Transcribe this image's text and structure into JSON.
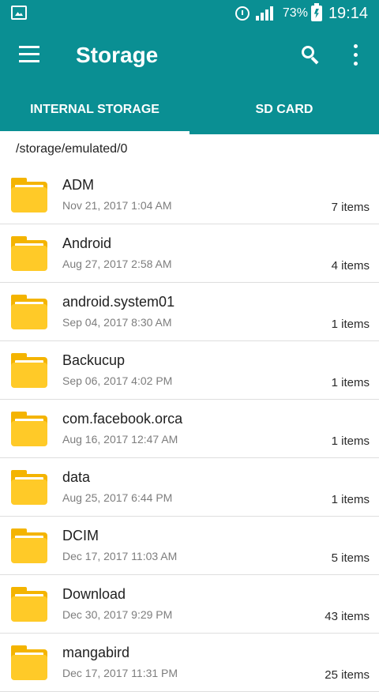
{
  "status": {
    "battery_percent": "73%",
    "time": "19:14"
  },
  "appbar": {
    "title": "Storage"
  },
  "tabs": [
    {
      "label": "INTERNAL STORAGE",
      "selected": true
    },
    {
      "label": "SD CARD",
      "selected": false
    }
  ],
  "path": "/storage/emulated/0",
  "files": [
    {
      "name": "ADM",
      "date": "Nov 21, 2017 1:04 AM",
      "count": "7 items"
    },
    {
      "name": "Android",
      "date": "Aug 27, 2017 2:58 AM",
      "count": "4 items"
    },
    {
      "name": "android.system01",
      "date": "Sep 04, 2017 8:30 AM",
      "count": "1 items"
    },
    {
      "name": "Backucup",
      "date": "Sep 06, 2017 4:02 PM",
      "count": "1 items"
    },
    {
      "name": "com.facebook.orca",
      "date": "Aug 16, 2017 12:47 AM",
      "count": "1 items"
    },
    {
      "name": "data",
      "date": "Aug 25, 2017 6:44 PM",
      "count": "1 items"
    },
    {
      "name": "DCIM",
      "date": "Dec 17, 2017 11:03 AM",
      "count": "5 items"
    },
    {
      "name": "Download",
      "date": "Dec 30, 2017 9:29 PM",
      "count": "43 items"
    },
    {
      "name": "mangabird",
      "date": "Dec 17, 2017 11:31 PM",
      "count": "25 items"
    }
  ],
  "colors": {
    "primary": "#0a8f93",
    "folder": "#ffca28",
    "folder_back": "#f4b400",
    "text": "#1f1f1f",
    "subtext": "#7d7d7d"
  },
  "icons": [
    "image-icon",
    "alarm-icon",
    "signal-icon",
    "battery-icon",
    "menu-icon",
    "search-icon",
    "more-vert-icon",
    "folder-icon"
  ]
}
